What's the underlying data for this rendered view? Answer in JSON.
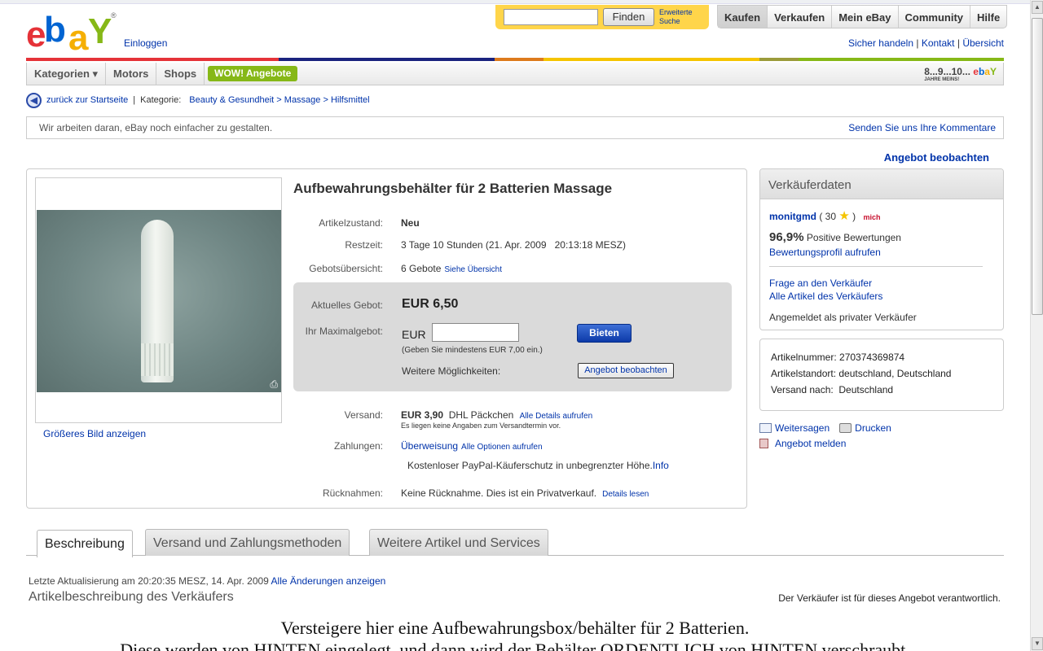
{
  "header": {
    "logo_text": "ebay",
    "logo_registered": "®",
    "signin": "Einloggen",
    "search": {
      "value": "",
      "button": "Finden",
      "advanced": "Erweiterte Suche"
    },
    "nav_tabs": [
      "Kaufen",
      "Verkaufen",
      "Mein eBay",
      "Community",
      "Hilfe"
    ],
    "links": [
      "Sicher handeln",
      "Kontakt",
      "Übersicht"
    ]
  },
  "colors": {
    "red": "#e53238",
    "blue": "#0064d2",
    "orange": "#dd7a1c",
    "yellow": "#f5c400",
    "green": "#86b817",
    "link": "#0033aa"
  },
  "catbar": {
    "items": [
      "Kategorien ▾",
      "Motors",
      "Shops"
    ],
    "wow": "WOW! Angebote",
    "birthday": "8...9...10...",
    "birthday_sub": "JAHRE MEINS!"
  },
  "breadcrumb": {
    "back": "zurück zur Startseite",
    "category_label": "Kategorie:",
    "path": "Beauty & Gesundheit > Massage > Hilfsmittel"
  },
  "notice": {
    "text": "Wir arbeiten daran, eBay noch einfacher zu gestalten.",
    "link": "Senden Sie uns Ihre Kommentare"
  },
  "watch_link": "Angebot beobachten",
  "item": {
    "title": "Aufbewahrungsbehälter für 2 Batterien Massage",
    "bigger_image": "Größeres Bild anzeigen",
    "condition": {
      "label": "Artikelzustand:",
      "value": "Neu"
    },
    "time_left": {
      "label": "Restzeit:",
      "value": "3 Tage 10 Stunden (21. Apr. 2009   20:13:18 MESZ)"
    },
    "bids": {
      "label": "Gebotsübersicht:",
      "value": "6 Gebote",
      "link": "Siehe Übersicht"
    },
    "current_bid": {
      "label": "Aktuelles Gebot:",
      "value": "EUR 6,50"
    },
    "max_bid": {
      "label": "Ihr Maximalgebot:",
      "currency": "EUR",
      "value": "",
      "hint": "(Geben Sie mindestens EUR 7,00 ein.)"
    },
    "bid_button": "Bieten",
    "more_options": "Weitere Möglichkeiten:",
    "watch_button": "Angebot beobachten",
    "shipping": {
      "label": "Versand:",
      "price": "EUR 3,90",
      "method": "DHL Päckchen",
      "link": "Alle Details aufrufen",
      "note": "Es liegen keine Angaben zum Versandtermin vor."
    },
    "payment": {
      "label": "Zahlungen:",
      "value": "Überweisung",
      "link": "Alle Optionen aufrufen",
      "paypal": "Kostenloser PayPal-Käuferschutz in unbegrenzter Höhe.",
      "paypal_link": "Info"
    },
    "returns": {
      "label": "Rücknahmen:",
      "value": "Keine Rücknahme. Dies ist ein Privatverkauf.",
      "link": "Details lesen"
    }
  },
  "seller": {
    "header": "Verkäuferdaten",
    "name": "monitgmd",
    "score_open": "( 30",
    "score_close": ")",
    "me_badge": "mich",
    "positive_pct": "96,9%",
    "positive_label": "Positive Bewertungen",
    "profile_link": "Bewertungsprofil aufrufen",
    "ask": "Frage an den Verkäufer",
    "all_items": "Alle Artikel des Verkäufers",
    "type": "Angemeldet als privater Verkäufer"
  },
  "info": {
    "item_number": "Artikelnummer: 270374369874",
    "location": "Artikelstandort: deutschland, Deutschland",
    "ships_to": "Versand nach:  Deutschland"
  },
  "actions": {
    "forward": "Weitersagen",
    "print": "Drucken",
    "report": "Angebot melden"
  },
  "tabs": [
    "Beschreibung",
    "Versand und Zahlungsmethoden",
    "Weitere Artikel und Services"
  ],
  "description": {
    "updated": "Letzte Aktualisierung am 20:20:35 MESZ, 14. Apr. 2009",
    "updated_link": "Alle Änderungen anzeigen",
    "title": "Artikelbeschreibung des Verkäufers",
    "responsibility": "Der Verkäufer ist für dieses Angebot verantwortlich.",
    "line1": "Versteigere hier eine Aufbewahrungsbox/behälter für 2 Batterien.",
    "line2": "Diese werden von HINTEN eingelegt, und dann wird der Behälter ORDENTLICH von HINTEN verschraubt."
  }
}
